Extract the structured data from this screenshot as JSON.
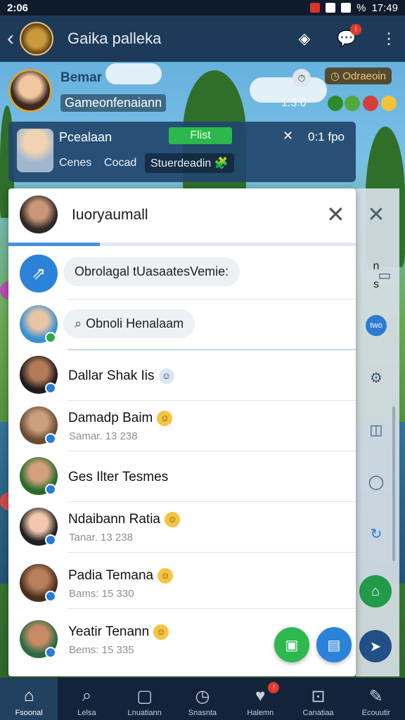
{
  "status_bar": {
    "time_left": "2:06",
    "time_right": "17:49",
    "battery": "%"
  },
  "app_bar": {
    "title": "Gaika palleka",
    "notification_count": "!"
  },
  "profile": {
    "name": "Bemar",
    "subtitle": "Gameonfenaiann",
    "tag": "Odraeoin",
    "time": "1.3:0",
    "tag_icon": "clock-icon"
  },
  "info_card": {
    "title": "Pcealaan",
    "pill_label": "Flist",
    "count": "0:1 fpo",
    "chips": [
      "Cenes",
      "Cocad",
      "Stuerdeadin"
    ]
  },
  "panel": {
    "title": "Iuoryaumall",
    "share_bubble": "Obrolagal tUasaatesVemie:",
    "search_bubble": "Obnoli Henalaam",
    "contacts": [
      {
        "name": "Dallar Shak Iis",
        "sub": "",
        "emoji": true
      },
      {
        "name": "Damadp Baim",
        "sub": "Samar. 13 238",
        "emoji": true
      },
      {
        "name": "Ges Ilter Tesmes",
        "sub": "",
        "emoji": false
      },
      {
        "name": "Ndaibann Ratia",
        "sub": "Tanar. 13 238",
        "emoji": true
      },
      {
        "name": "Padia Temana",
        "sub": "Bams: 15 330",
        "emoji": true
      },
      {
        "name": "Yeatir Tenann",
        "sub": "Bems: 15 335",
        "emoji": true
      }
    ]
  },
  "side_strip": {
    "label_m": "n",
    "label_s": "s",
    "badge_text": "two"
  },
  "bottom_nav": [
    {
      "label": "Fsoonal",
      "icon": "home-icon",
      "active": true
    },
    {
      "label": "Lelsa",
      "icon": "search-icon",
      "active": false
    },
    {
      "label": "Lnuatiann",
      "icon": "bag-icon",
      "active": false
    },
    {
      "label": "Snasnta",
      "icon": "clock-icon",
      "active": false
    },
    {
      "label": "Halemn",
      "icon": "heart-icon",
      "active": false,
      "badge": "!"
    },
    {
      "label": "Canatiaa",
      "icon": "frame-icon",
      "active": false
    },
    {
      "label": "Ecouutir",
      "icon": "edit-icon",
      "active": false
    }
  ],
  "colors": {
    "accent": "#2b82d9",
    "green": "#2fa84b",
    "nav_bg": "#13233a"
  }
}
